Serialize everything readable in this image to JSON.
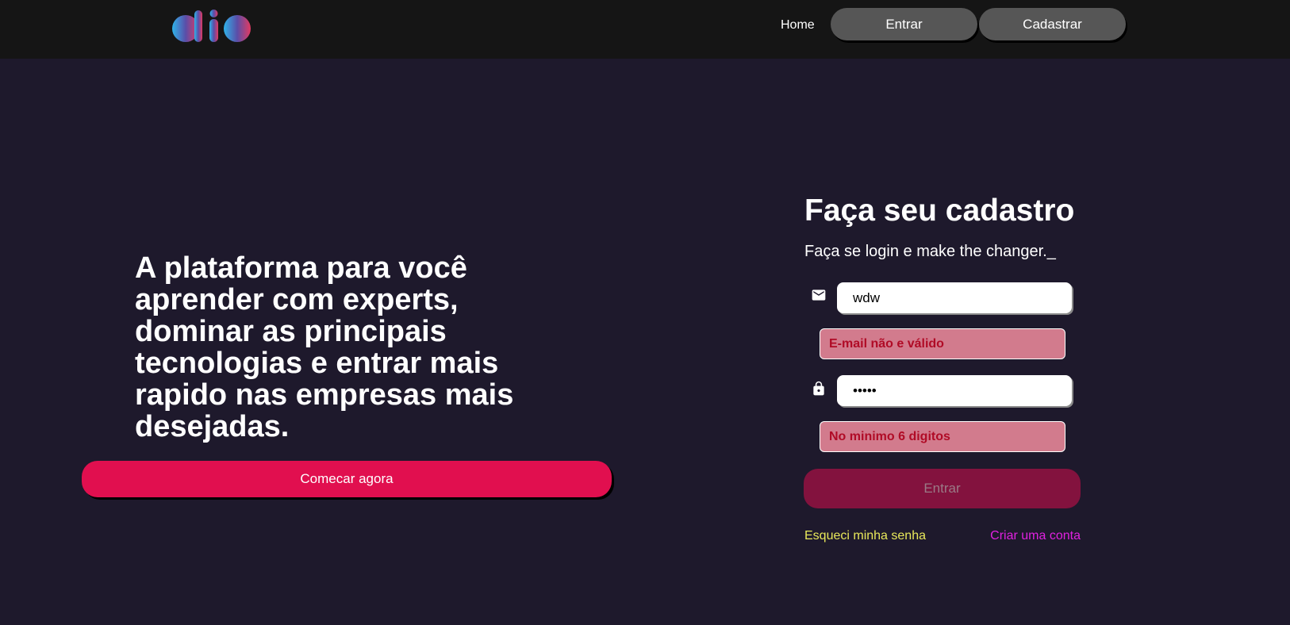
{
  "header": {
    "logo_text": "dio",
    "nav": {
      "home_label": "Home",
      "login_label": "Entrar",
      "signup_label": "Cadastrar"
    }
  },
  "hero": {
    "title": "A plataforma para você aprender com experts, dominar as principais tecnologias e entrar mais rapido nas empresas mais desejadas.",
    "cta_label": "Comecar agora"
  },
  "form": {
    "title": "Faça seu cadastro",
    "subtitle": "Faça se login e make the changer._",
    "email": {
      "value": "wdw",
      "icon": "mail-icon",
      "error": "E-mail não e válido"
    },
    "password": {
      "value": "•••••",
      "icon": "lock-icon",
      "error": "No minimo 6 digitos"
    },
    "submit_label": "Entrar",
    "forgot_label": "Esqueci minha senha",
    "create_label": "Criar uma conta"
  },
  "colors": {
    "background": "#1e192c",
    "header": "#151515",
    "cta": "#e10f4f",
    "submit": "#83123e",
    "error_bg": "#d27b8d",
    "error_text": "#b00b26",
    "forgot_link": "#e8e85a",
    "create_link": "#e021e0"
  }
}
